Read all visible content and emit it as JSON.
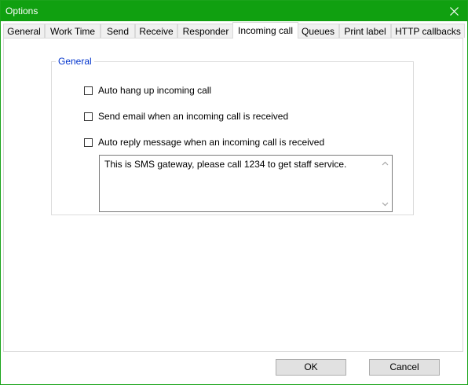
{
  "window": {
    "title": "Options"
  },
  "tabs": [
    {
      "label": "General"
    },
    {
      "label": "Work Time"
    },
    {
      "label": "Send"
    },
    {
      "label": "Receive"
    },
    {
      "label": "Responder"
    },
    {
      "label": "Incoming call",
      "active": true
    },
    {
      "label": "Queues"
    },
    {
      "label": "Print label"
    },
    {
      "label": "HTTP callbacks"
    }
  ],
  "group": {
    "legend": "General",
    "checkboxes": [
      {
        "label": "Auto hang up incoming call",
        "checked": false
      },
      {
        "label": "Send email when an incoming call is received",
        "checked": false
      },
      {
        "label": "Auto reply message when an incoming call is received",
        "checked": false
      }
    ],
    "reply_message": "This is SMS gateway, please call 1234 to get staff service."
  },
  "buttons": {
    "ok_label": "OK",
    "cancel_label": "Cancel"
  },
  "colors": {
    "titlebar": "#10a010",
    "legend_text": "#0033cc"
  }
}
